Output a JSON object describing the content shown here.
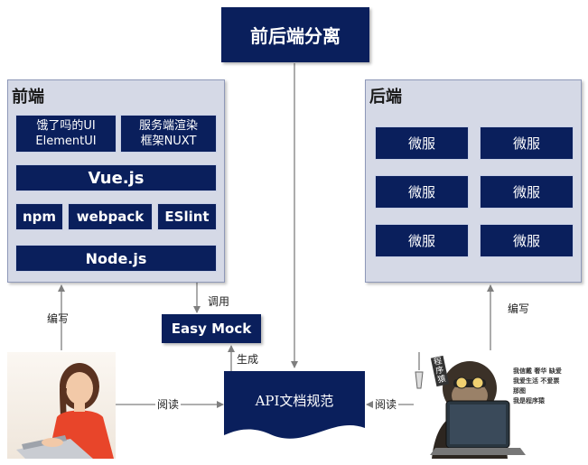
{
  "title": "前后端分离",
  "frontend": {
    "title": "前端",
    "ui_lib": [
      "饿了吗的UI",
      "ElementUI"
    ],
    "ssr": [
      "服务端渲染",
      "框架NUXT"
    ],
    "vue": "Vue.js",
    "npm": "npm",
    "webpack": "webpack",
    "eslint": "ESlint",
    "node": "Node.js"
  },
  "backend": {
    "title": "后端",
    "services": [
      "微服",
      "微服",
      "微服",
      "微服",
      "微服",
      "微服"
    ]
  },
  "easy_mock": "Easy Mock",
  "api_doc": "API文档规范",
  "labels": {
    "call": "调用",
    "write_left": "编写",
    "write_right": "编写",
    "generate": "生成",
    "read_left": "阅读",
    "read_right": "阅读"
  },
  "monkey_sign": "程序猿",
  "monkey_text": [
    "我信戴 奢华 缺爱",
    "我爱生活 不爱票那图",
    "我是程序猿"
  ],
  "colors": {
    "navy": "#0a1f5c",
    "panel": "#d5d9e6",
    "arrow": "#7f7f7f"
  }
}
